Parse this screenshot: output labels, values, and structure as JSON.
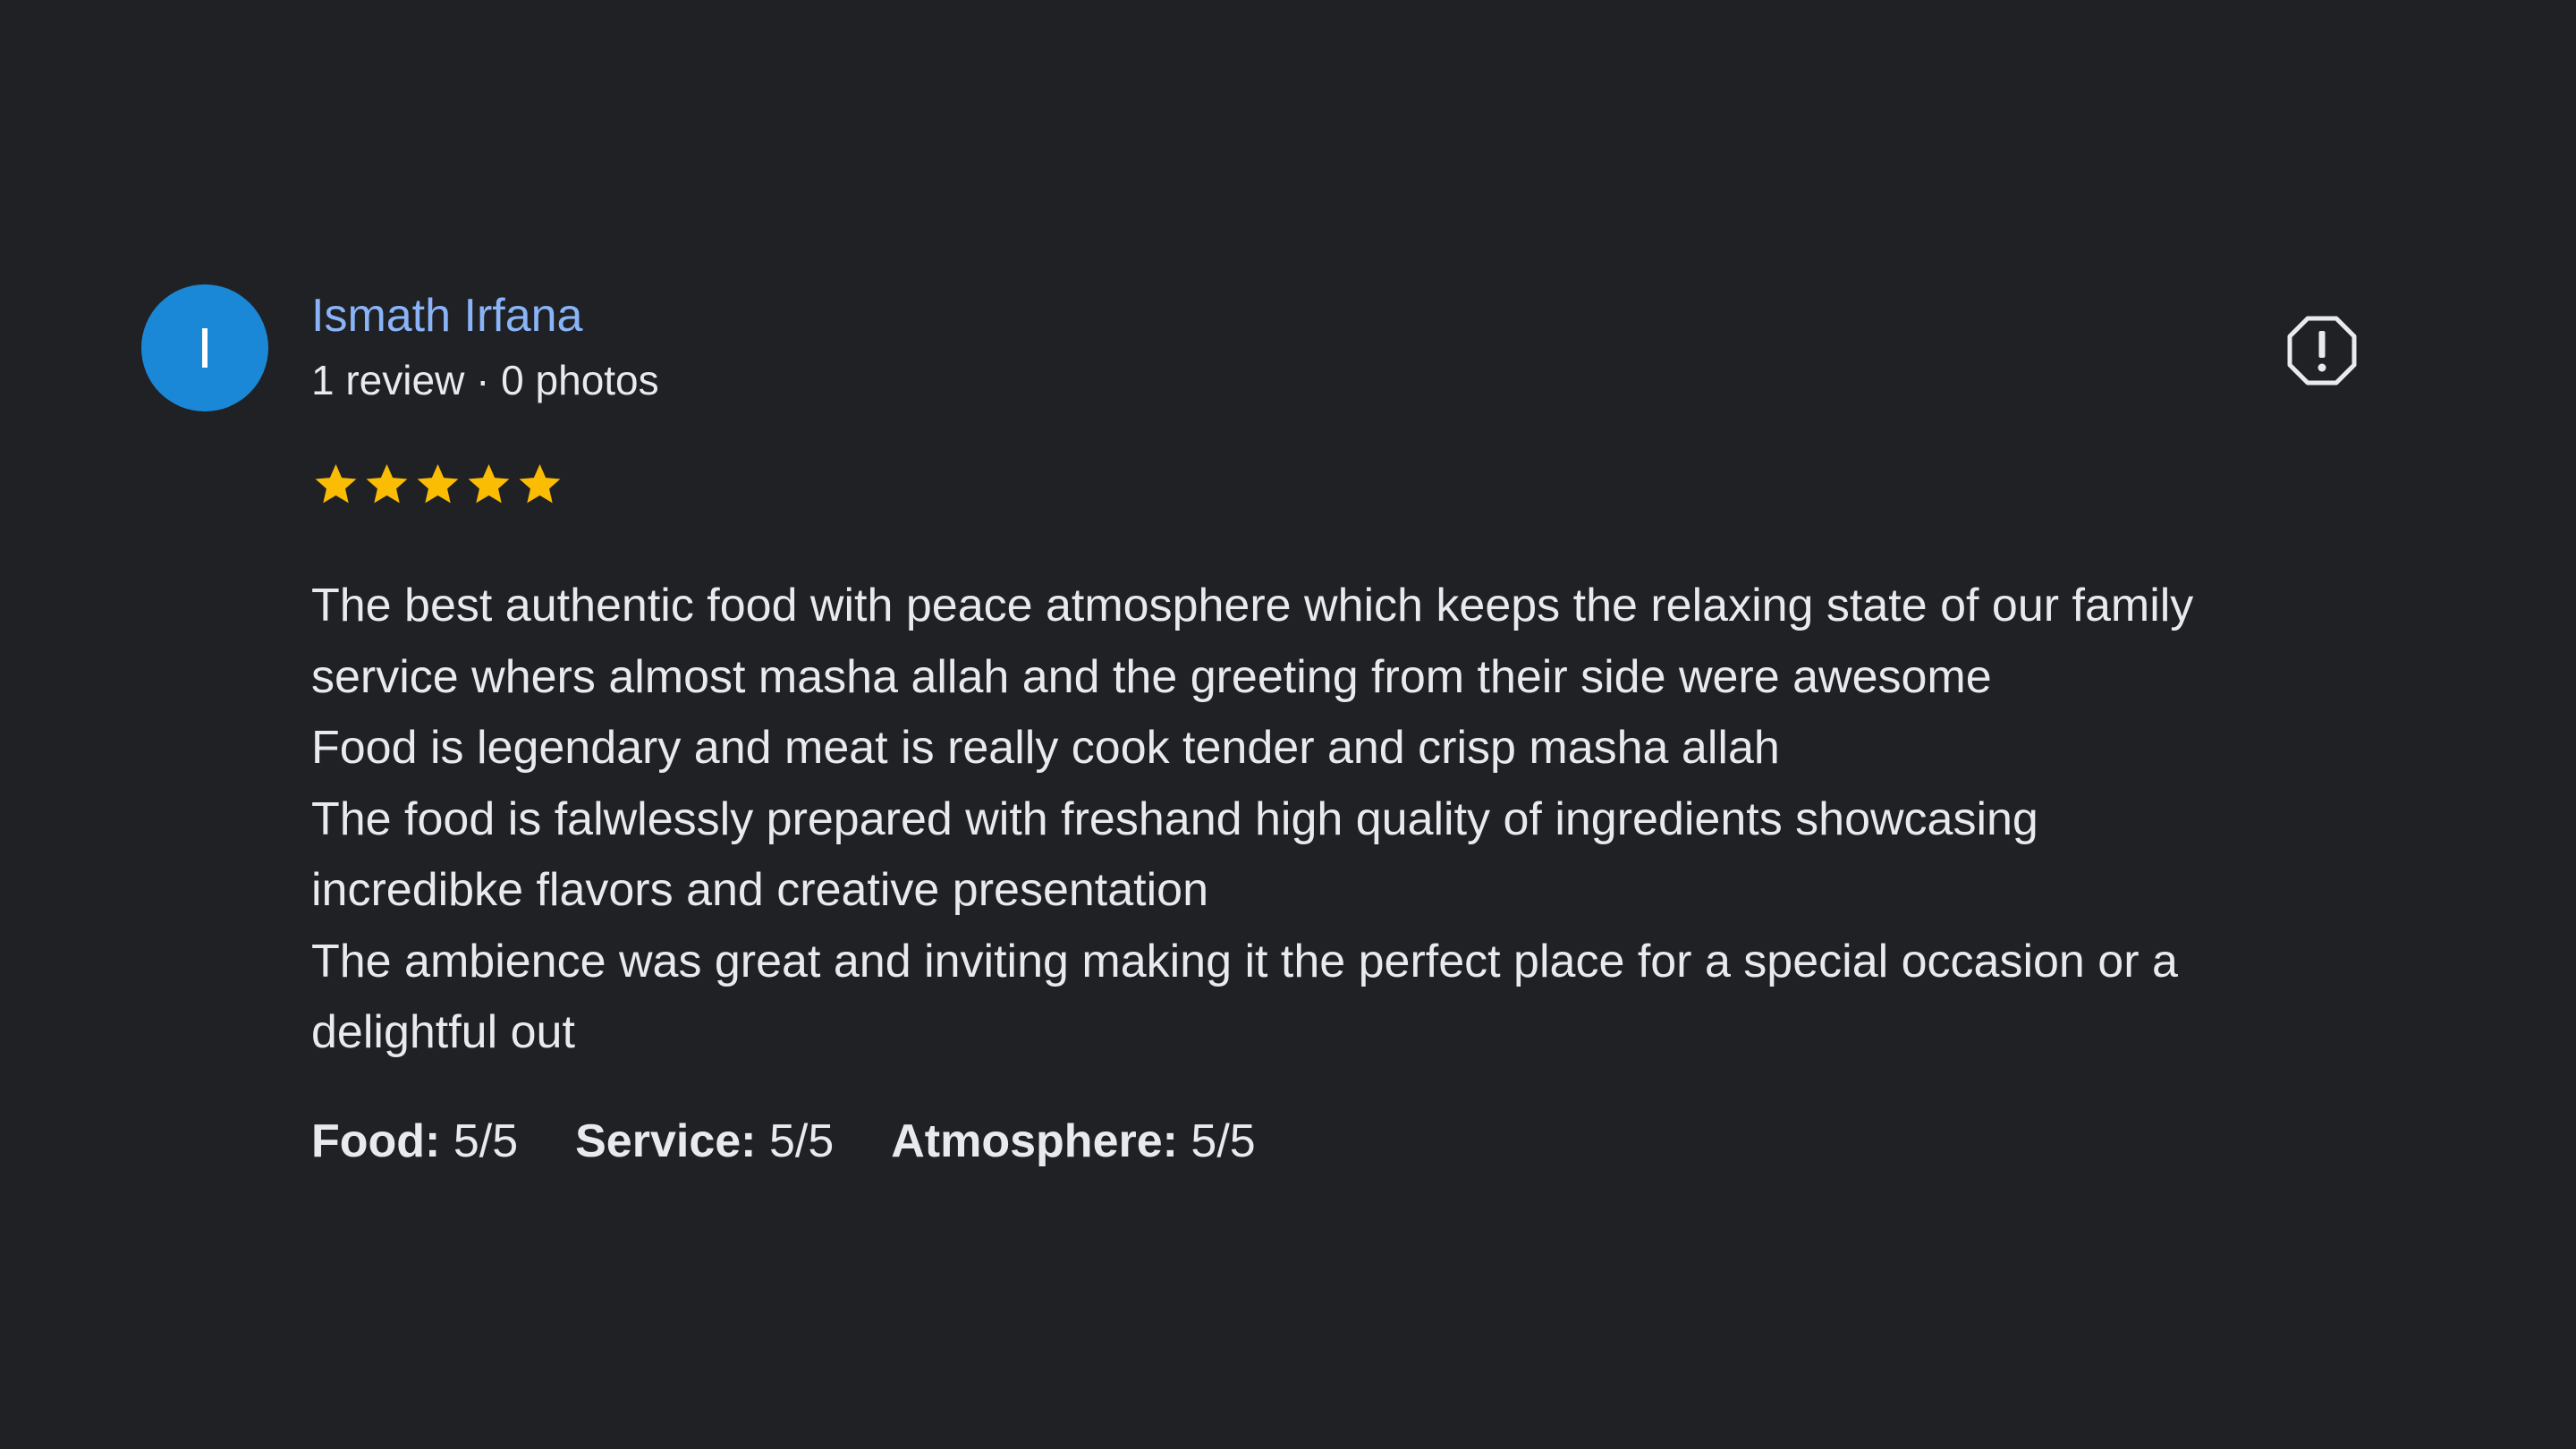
{
  "review": {
    "avatar_letter": "I",
    "avatar_color": "#1a88d6",
    "reviewer_name": "Ismath Irfana",
    "reviewer_meta": "1 review · 0 photos",
    "star_rating": 5,
    "star_max": 5,
    "star_color": "#fbbc04",
    "report_icon": "report-flag-icon",
    "text_lines": [
      "The best authentic food with peace atmosphere which keeps the relaxing state of our family",
      "service whers almost masha allah and the greeting from their side were awesome",
      "Food is legendary and meat is really cook tender and crisp masha allah",
      "The food is falwlessly prepared with freshand high quality of ingredients showcasing",
      "incredibke flavors and creative presentation",
      "The ambience was great and inviting making it the perfect place for a special occasion or a",
      "delightful out"
    ],
    "ratings": [
      {
        "label": "Food:",
        "value": "5/5"
      },
      {
        "label": "Service:",
        "value": "5/5"
      },
      {
        "label": "Atmosphere:",
        "value": "5/5"
      }
    ]
  }
}
